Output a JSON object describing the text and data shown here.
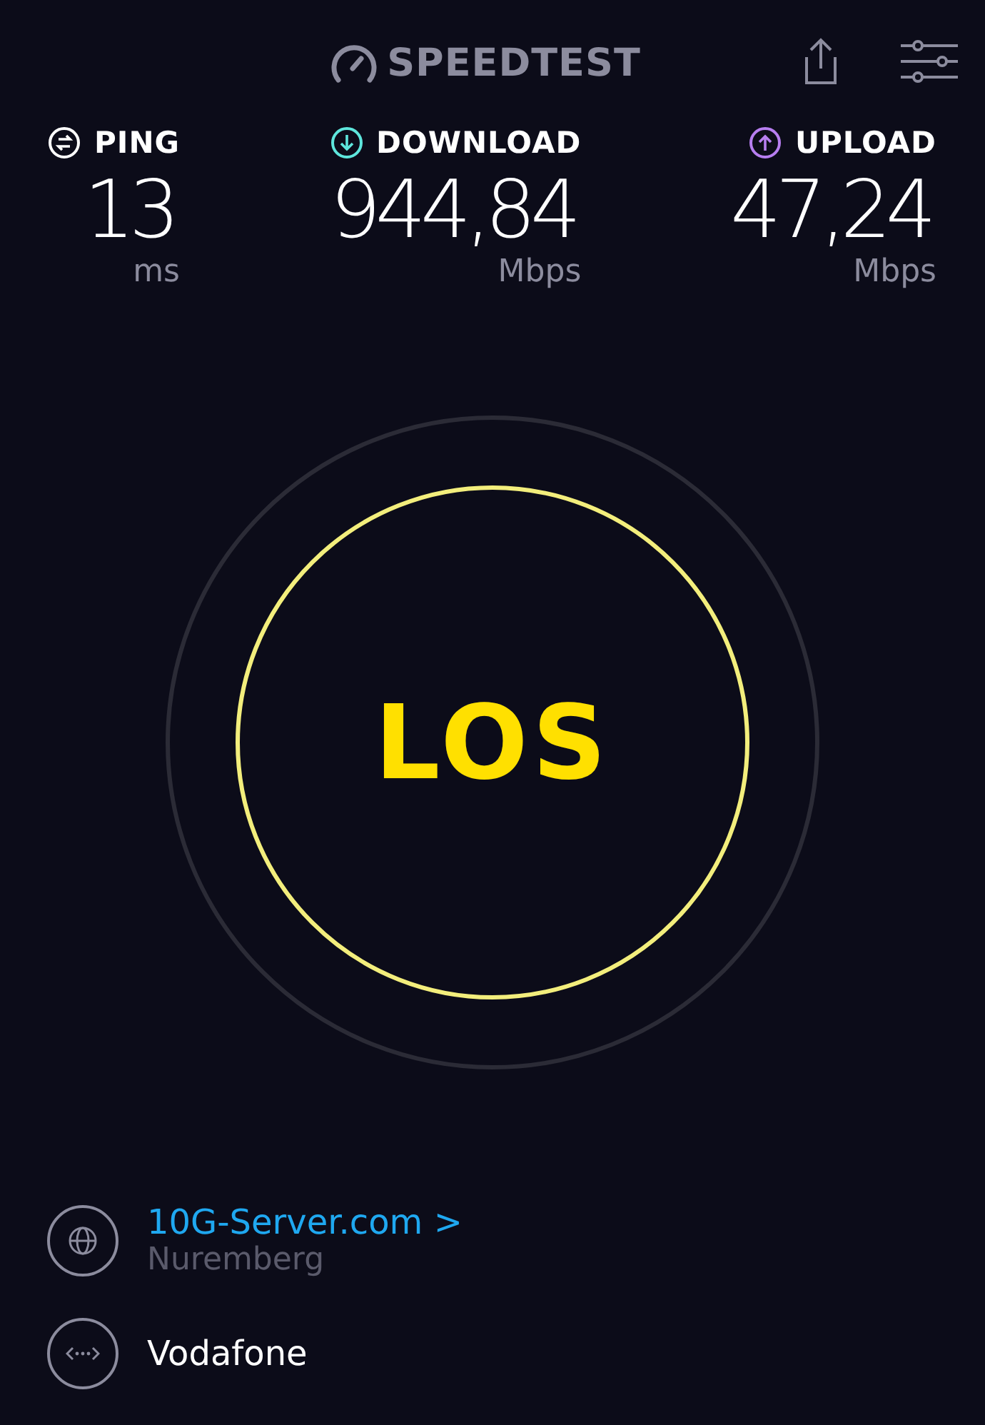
{
  "header": {
    "logo": "SPEEDTEST"
  },
  "metrics": [
    {
      "kind": "ping",
      "label": "PING",
      "value": "13",
      "unit": "ms",
      "color": "#ffffff"
    },
    {
      "kind": "download",
      "label": "DOWNLOAD",
      "value": "944,84",
      "unit": "Mbps",
      "color": "#5ee6dc"
    },
    {
      "kind": "upload",
      "label": "UPLOAD",
      "value": "47,24",
      "unit": "Mbps",
      "color": "#b77ef0"
    }
  ],
  "go_button": {
    "label": "LOS"
  },
  "server": {
    "name": "10G-Server.com",
    "chevron": ">",
    "location": "Nuremberg"
  },
  "provider": {
    "name": "Vodafone"
  }
}
